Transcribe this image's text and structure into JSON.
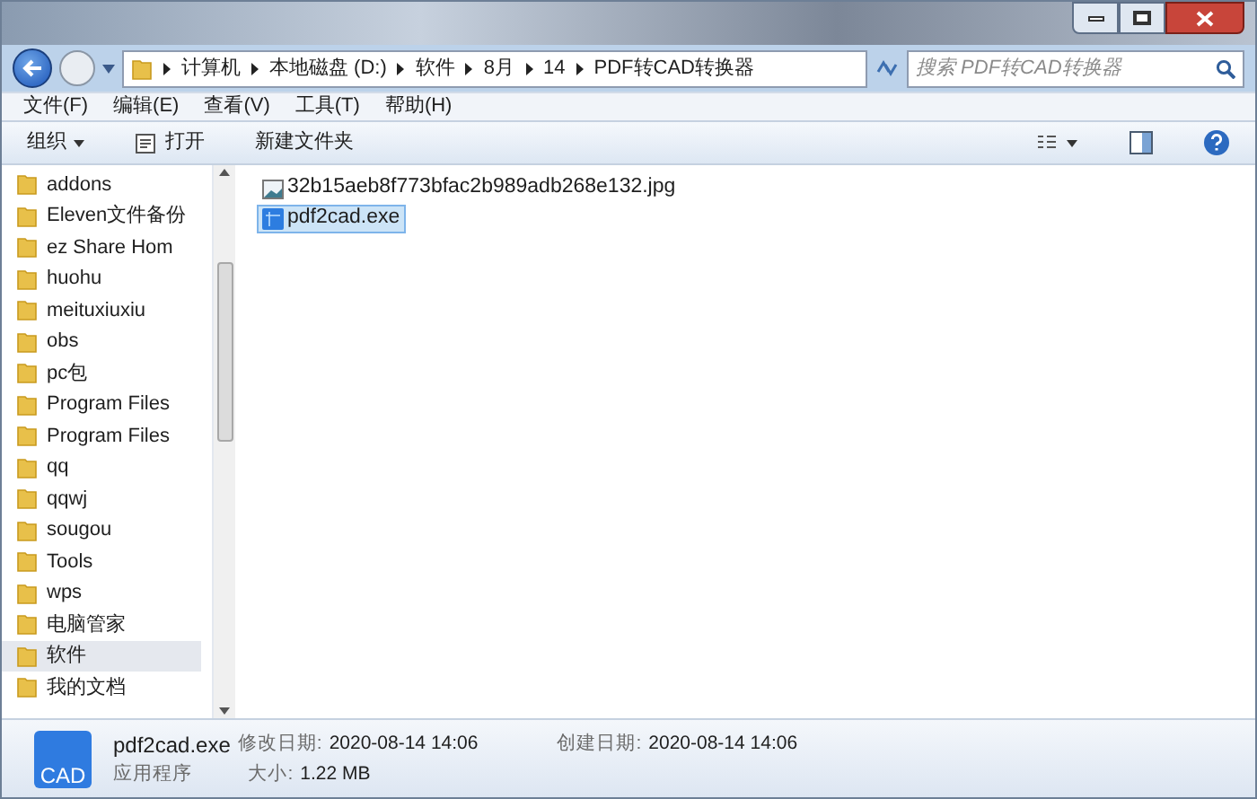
{
  "breadcrumb": [
    "计算机",
    "本地磁盘 (D:)",
    "软件",
    "8月",
    "14",
    "PDF转CAD转换器"
  ],
  "search": {
    "placeholder": "搜索 PDF转CAD转换器"
  },
  "menu": [
    "文件(F)",
    "编辑(E)",
    "查看(V)",
    "工具(T)",
    "帮助(H)"
  ],
  "toolbar": [
    {
      "label": "组织",
      "kind": "dropdown"
    },
    {
      "label": "打开",
      "kind": "icon"
    },
    {
      "label": "新建文件夹",
      "kind": "plain"
    }
  ],
  "sidebar": {
    "items": [
      {
        "label": "addons",
        "selected": false
      },
      {
        "label": "Eleven文件备份",
        "selected": false
      },
      {
        "label": "ez Share Hom",
        "selected": false
      },
      {
        "label": "huohu",
        "selected": false
      },
      {
        "label": "meituxiuxiu",
        "selected": false
      },
      {
        "label": "obs",
        "selected": false
      },
      {
        "label": "pc包",
        "selected": false
      },
      {
        "label": "Program Files",
        "selected": false
      },
      {
        "label": "Program Files",
        "selected": false
      },
      {
        "label": "qq",
        "selected": false
      },
      {
        "label": "qqwj",
        "selected": false
      },
      {
        "label": "sougou",
        "selected": false
      },
      {
        "label": "Tools",
        "selected": false
      },
      {
        "label": "wps",
        "selected": false
      },
      {
        "label": "电脑管家",
        "selected": false
      },
      {
        "label": "软件",
        "selected": true
      },
      {
        "label": "我的文档",
        "selected": false
      }
    ]
  },
  "files": [
    {
      "name": "32b15aeb8f773bfac2b989adb268e132.jpg",
      "kind": "image",
      "selected": false
    },
    {
      "name": "pdf2cad.exe",
      "kind": "exe",
      "selected": true
    }
  ],
  "details": {
    "icon_text": "CAD",
    "name": "pdf2cad.exe",
    "type": "应用程序",
    "modified_label": "修改日期:",
    "modified": "2020-08-14 14:06",
    "created_label": "创建日期:",
    "created": "2020-08-14 14:06",
    "size_label": "大小:",
    "size": "1.22 MB"
  }
}
